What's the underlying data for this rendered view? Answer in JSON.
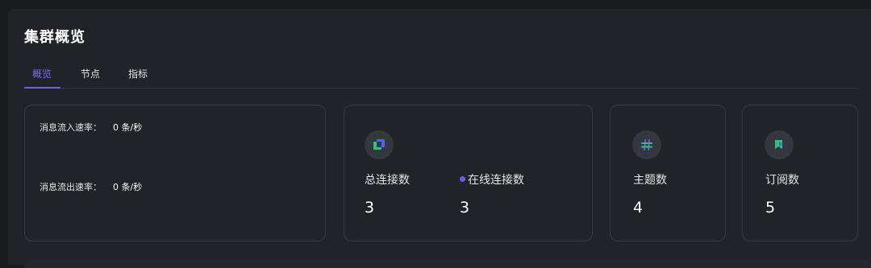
{
  "page": {
    "title": "集群概览"
  },
  "tabs": [
    {
      "label": "概览",
      "active": true
    },
    {
      "label": "节点",
      "active": false
    },
    {
      "label": "指标",
      "active": false
    }
  ],
  "rates": {
    "in_label": "消息流入速率：",
    "in_value": "0 条/秒",
    "out_label": "消息流出速率：",
    "out_value": "0 条/秒"
  },
  "connections": {
    "total_label": "总连接数",
    "total_value": "3",
    "online_label": "在线连接数",
    "online_value": "3",
    "icon": "connections-icon"
  },
  "topics": {
    "label": "主题数",
    "value": "4",
    "icon": "hash-icon"
  },
  "subscriptions": {
    "label": "订阅数",
    "value": "5",
    "icon": "subscription-flag-icon"
  },
  "colors": {
    "background": "#1a1b1f",
    "panel": "#222328",
    "accent": "#6e60f0",
    "icon_green": "#2fc56f",
    "icon_blue": "#5b5cf0"
  }
}
